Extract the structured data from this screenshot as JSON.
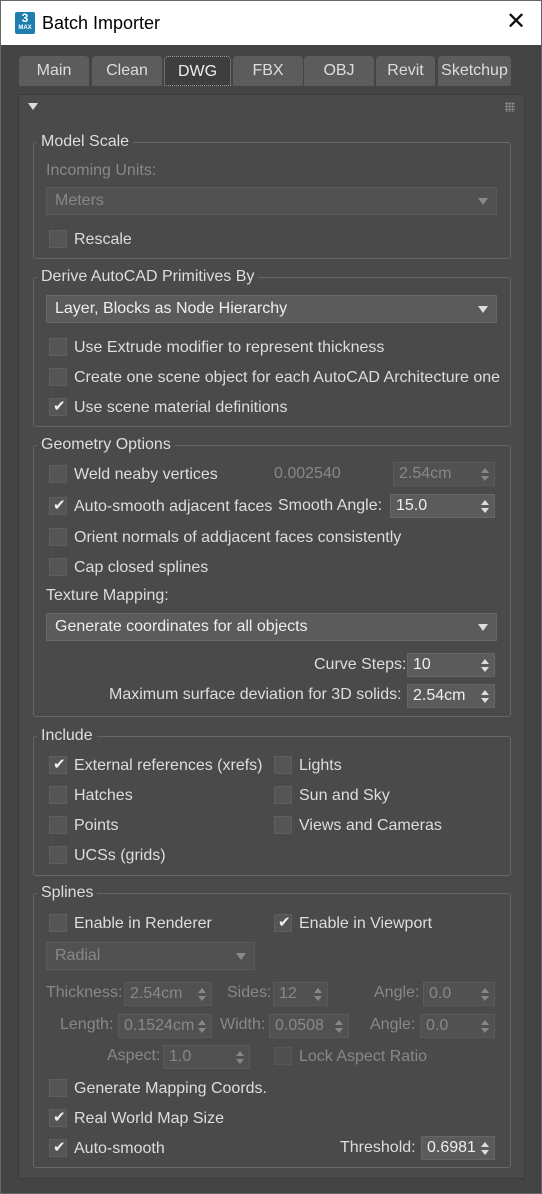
{
  "window": {
    "title": "Batch Importer",
    "app_icon_text": "3",
    "app_icon_sub": "MAX",
    "close_glyph": "✕"
  },
  "tabs": [
    "Main",
    "Clean",
    "DWG",
    "FBX",
    "OBJ",
    "Revit",
    "Sketchup"
  ],
  "active_tab": "DWG",
  "model_scale": {
    "title": "Model Scale",
    "incoming_units_label": "Incoming Units:",
    "incoming_units_value": "Meters",
    "rescale_label": "Rescale",
    "rescale_checked": false
  },
  "derive": {
    "title": "Derive AutoCAD Primitives By",
    "value": "Layer, Blocks as Node Hierarchy",
    "extrude_label": "Use Extrude modifier to represent thickness",
    "extrude_checked": false,
    "one_object_label": "Create one scene object for each AutoCAD Architecture one",
    "one_object_checked": false,
    "material_label": "Use scene material definitions",
    "material_checked": true
  },
  "geometry": {
    "title": "Geometry Options",
    "weld_label": "Weld neaby vertices",
    "weld_checked": false,
    "weld_threshold": "0.002540",
    "weld_spinner": "2.54cm",
    "autosmooth_label": "Auto-smooth adjacent faces",
    "autosmooth_checked": true,
    "smooth_angle_label": "Smooth Angle:",
    "smooth_angle_value": "15.0",
    "orient_label": "Orient normals of addjacent faces consistently",
    "orient_checked": false,
    "cap_label": "Cap closed splines",
    "cap_checked": false,
    "texture_label": "Texture Mapping:",
    "texture_value": "Generate coordinates for all objects",
    "curve_steps_label": "Curve Steps:",
    "curve_steps_value": "10",
    "max_dev_label": "Maximum surface deviation for 3D solids:",
    "max_dev_value": "2.54cm"
  },
  "include": {
    "title": "Include",
    "items": [
      {
        "label": "External references (xrefs)",
        "checked": true
      },
      {
        "label": "Lights",
        "checked": false
      },
      {
        "label": "Hatches",
        "checked": false
      },
      {
        "label": "Sun and Sky",
        "checked": false
      },
      {
        "label": "Points",
        "checked": false
      },
      {
        "label": "Views and Cameras",
        "checked": false
      },
      {
        "label": "UCSs (grids)",
        "checked": false
      }
    ]
  },
  "splines": {
    "title": "Splines",
    "renderer_label": "Enable in Renderer",
    "renderer_checked": false,
    "viewport_label": "Enable in Viewport",
    "viewport_checked": true,
    "profile_value": "Radial",
    "thickness_label": "Thickness:",
    "thickness_value": "2.54cm",
    "sides_label": "Sides:",
    "sides_value": "12",
    "angle_label": "Angle:",
    "angle_value": "0.0",
    "length_label": "Length:",
    "length_value": "0.1524cm",
    "width_label": "Width:",
    "width_value": "0.0508",
    "angle2_label": "Angle:",
    "angle2_value": "0.0",
    "aspect_label": "Aspect:",
    "aspect_value": "1.0",
    "lock_aspect_label": "Lock Aspect Ratio",
    "lock_aspect_checked": false,
    "mapping_label": "Generate Mapping Coords.",
    "mapping_checked": false,
    "real_world_label": "Real World Map Size",
    "real_world_checked": true,
    "autosmooth_label": "Auto-smooth",
    "autosmooth_checked": true,
    "threshold_label": "Threshold:",
    "threshold_value": "0.6981"
  },
  "check_glyph": "✔"
}
